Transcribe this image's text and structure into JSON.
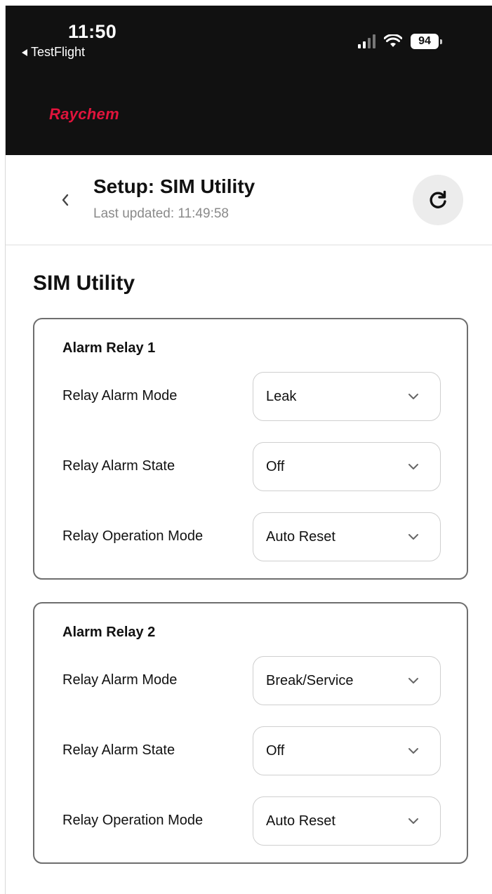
{
  "status_bar": {
    "time": "11:50",
    "back_app": "TestFlight",
    "battery": "94"
  },
  "brand": {
    "name": "Raychem",
    "color": "#e0143c"
  },
  "header": {
    "title": "Setup: SIM Utility",
    "last_updated": "Last updated: 11:49:58",
    "back_icon": "chevron-left-icon",
    "refresh_icon": "refresh-icon"
  },
  "section": {
    "title": "SIM Utility"
  },
  "relays": [
    {
      "title": "Alarm Relay 1",
      "rows": [
        {
          "label": "Relay Alarm Mode",
          "value": "Leak"
        },
        {
          "label": "Relay Alarm State",
          "value": "Off"
        },
        {
          "label": "Relay Operation Mode",
          "value": "Auto Reset"
        }
      ]
    },
    {
      "title": "Alarm Relay 2",
      "rows": [
        {
          "label": "Relay Alarm Mode",
          "value": "Break/Service"
        },
        {
          "label": "Relay Alarm State",
          "value": "Off"
        },
        {
          "label": "Relay Operation Mode",
          "value": "Auto Reset"
        }
      ]
    }
  ]
}
